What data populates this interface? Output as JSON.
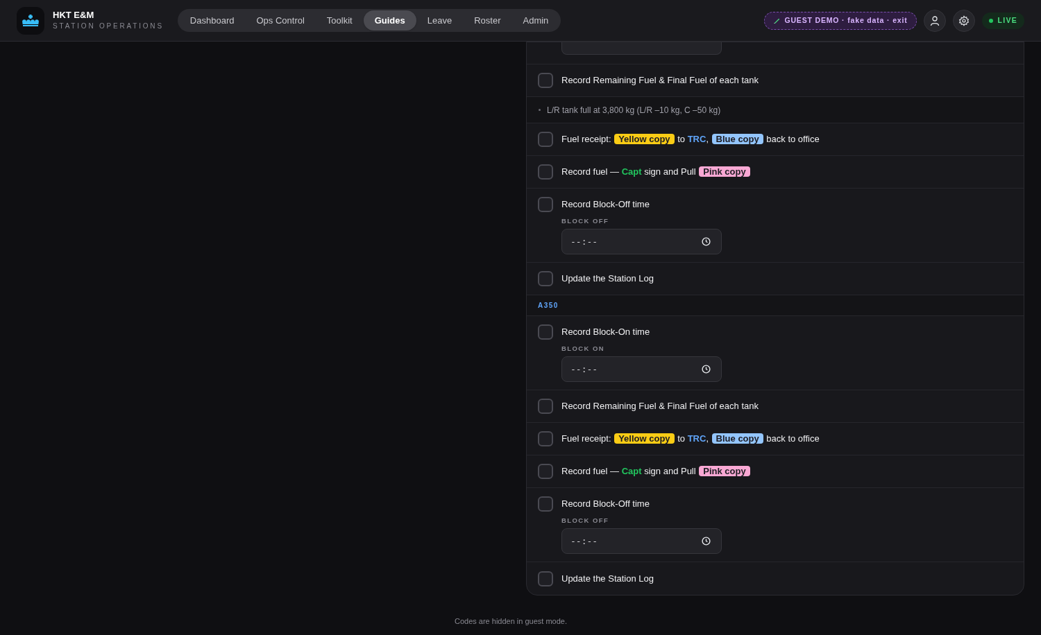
{
  "brand": {
    "title": "HKT E&M",
    "subtitle": "STATION OPERATIONS"
  },
  "tabs": [
    {
      "label": "Dashboard",
      "selected": false
    },
    {
      "label": "Ops Control",
      "selected": false
    },
    {
      "label": "Toolkit",
      "selected": false
    },
    {
      "label": "Guides",
      "selected": true
    },
    {
      "label": "Leave",
      "selected": false
    },
    {
      "label": "Roster",
      "selected": false
    },
    {
      "label": "Admin",
      "selected": false
    }
  ],
  "guest_badge": "GUEST DEMO · fake data · exit",
  "status": {
    "label": "LIVE",
    "on": true
  },
  "checklist": [
    {
      "kind": "field"
    },
    {
      "kind": "task",
      "checked": false,
      "parts": [
        {
          "kind": "text",
          "text": "Record Remaining Fuel & Final Fuel of each tank"
        }
      ]
    },
    {
      "kind": "note",
      "text": "L/R tank full at 3,800 kg (L/R –10 kg, C –50 kg)"
    },
    {
      "kind": "task",
      "checked": false,
      "parts": [
        {
          "kind": "text",
          "text": "Fuel receipt: "
        },
        {
          "kind": "tag",
          "text": "Yellow copy",
          "color": "#facc15"
        },
        {
          "kind": "text",
          "text": " to "
        },
        {
          "kind": "accent",
          "text": "TRC",
          "color": "#60a5fa"
        },
        {
          "kind": "text",
          "text": ", "
        },
        {
          "kind": "tag",
          "text": "Blue copy",
          "color": "#93c5fd"
        },
        {
          "kind": "text",
          "text": " back to office"
        }
      ]
    },
    {
      "kind": "task",
      "checked": false,
      "parts": [
        {
          "kind": "text",
          "text": "Record fuel — "
        },
        {
          "kind": "accent",
          "text": "Capt",
          "color": "#22c55e"
        },
        {
          "kind": "text",
          "text": " sign and Pull "
        },
        {
          "kind": "tag",
          "text": "Pink copy",
          "color": "#f9a8d4"
        }
      ]
    },
    {
      "kind": "time",
      "checked": false,
      "title": "Record Block-Off time",
      "label": "BLOCK OFF",
      "value": "--:--"
    },
    {
      "kind": "task",
      "checked": false,
      "parts": [
        {
          "kind": "text",
          "text": "Update the Station Log"
        }
      ]
    },
    {
      "kind": "section",
      "text": "A350"
    },
    {
      "kind": "time",
      "checked": false,
      "title": "Record Block-On time",
      "label": "BLOCK ON",
      "value": "--:--"
    },
    {
      "kind": "task",
      "checked": false,
      "parts": [
        {
          "kind": "text",
          "text": "Record Remaining Fuel & Final Fuel of each tank"
        }
      ]
    },
    {
      "kind": "task",
      "checked": false,
      "parts": [
        {
          "kind": "text",
          "text": "Fuel receipt: "
        },
        {
          "kind": "tag",
          "text": "Yellow copy",
          "color": "#facc15"
        },
        {
          "kind": "text",
          "text": " to "
        },
        {
          "kind": "accent",
          "text": "TRC",
          "color": "#60a5fa"
        },
        {
          "kind": "text",
          "text": ", "
        },
        {
          "kind": "tag",
          "text": "Blue copy",
          "color": "#93c5fd"
        },
        {
          "kind": "text",
          "text": " back to office"
        }
      ]
    },
    {
      "kind": "task",
      "checked": false,
      "parts": [
        {
          "kind": "text",
          "text": "Record fuel — "
        },
        {
          "kind": "accent",
          "text": "Capt",
          "color": "#22c55e"
        },
        {
          "kind": "text",
          "text": " sign and Pull "
        },
        {
          "kind": "tag",
          "text": "Pink copy",
          "color": "#f9a8d4"
        }
      ]
    },
    {
      "kind": "time",
      "checked": false,
      "title": "Record Block-Off time",
      "label": "BLOCK OFF",
      "value": "--:--"
    },
    {
      "kind": "task",
      "checked": false,
      "parts": [
        {
          "kind": "text",
          "text": "Update the Station Log"
        }
      ]
    }
  ],
  "footer": "Codes are hidden in guest mode."
}
